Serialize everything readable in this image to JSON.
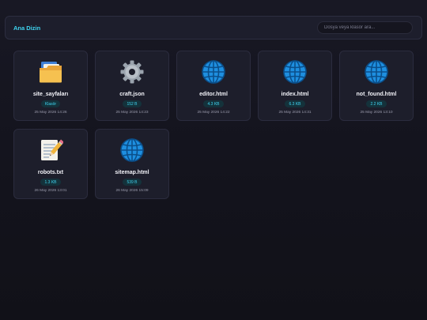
{
  "header": {
    "breadcrumb": "Ana Dizin",
    "search_placeholder": "Dosya veya klasör ara..."
  },
  "colors": {
    "accent": "#3fd4f0",
    "card_bg": "#1d1e2b",
    "page_bg": "#15151f"
  },
  "items": [
    {
      "name": "site_sayfaları",
      "badge": "Klasör",
      "date": "25 May 2026 14:26",
      "icon": "folder-icon"
    },
    {
      "name": "craft.json",
      "badge": "152 B",
      "date": "25 May 2026 14:23",
      "icon": "gear-icon"
    },
    {
      "name": "editor.html",
      "badge": "4.3 KB",
      "date": "25 May 2026 14:22",
      "icon": "globe-icon"
    },
    {
      "name": "index.html",
      "badge": "6.3 KB",
      "date": "25 May 2026 14:31",
      "icon": "globe-icon"
    },
    {
      "name": "not_found.html",
      "badge": "2.2 KB",
      "date": "25 May 2026 13:10",
      "icon": "globe-icon"
    },
    {
      "name": "robots.txt",
      "badge": "1.3 KB",
      "date": "26 May 2026 13:01",
      "icon": "memo-icon"
    },
    {
      "name": "sitemap.html",
      "badge": "539 B",
      "date": "26 May 2026 15:09",
      "icon": "globe-icon"
    }
  ]
}
